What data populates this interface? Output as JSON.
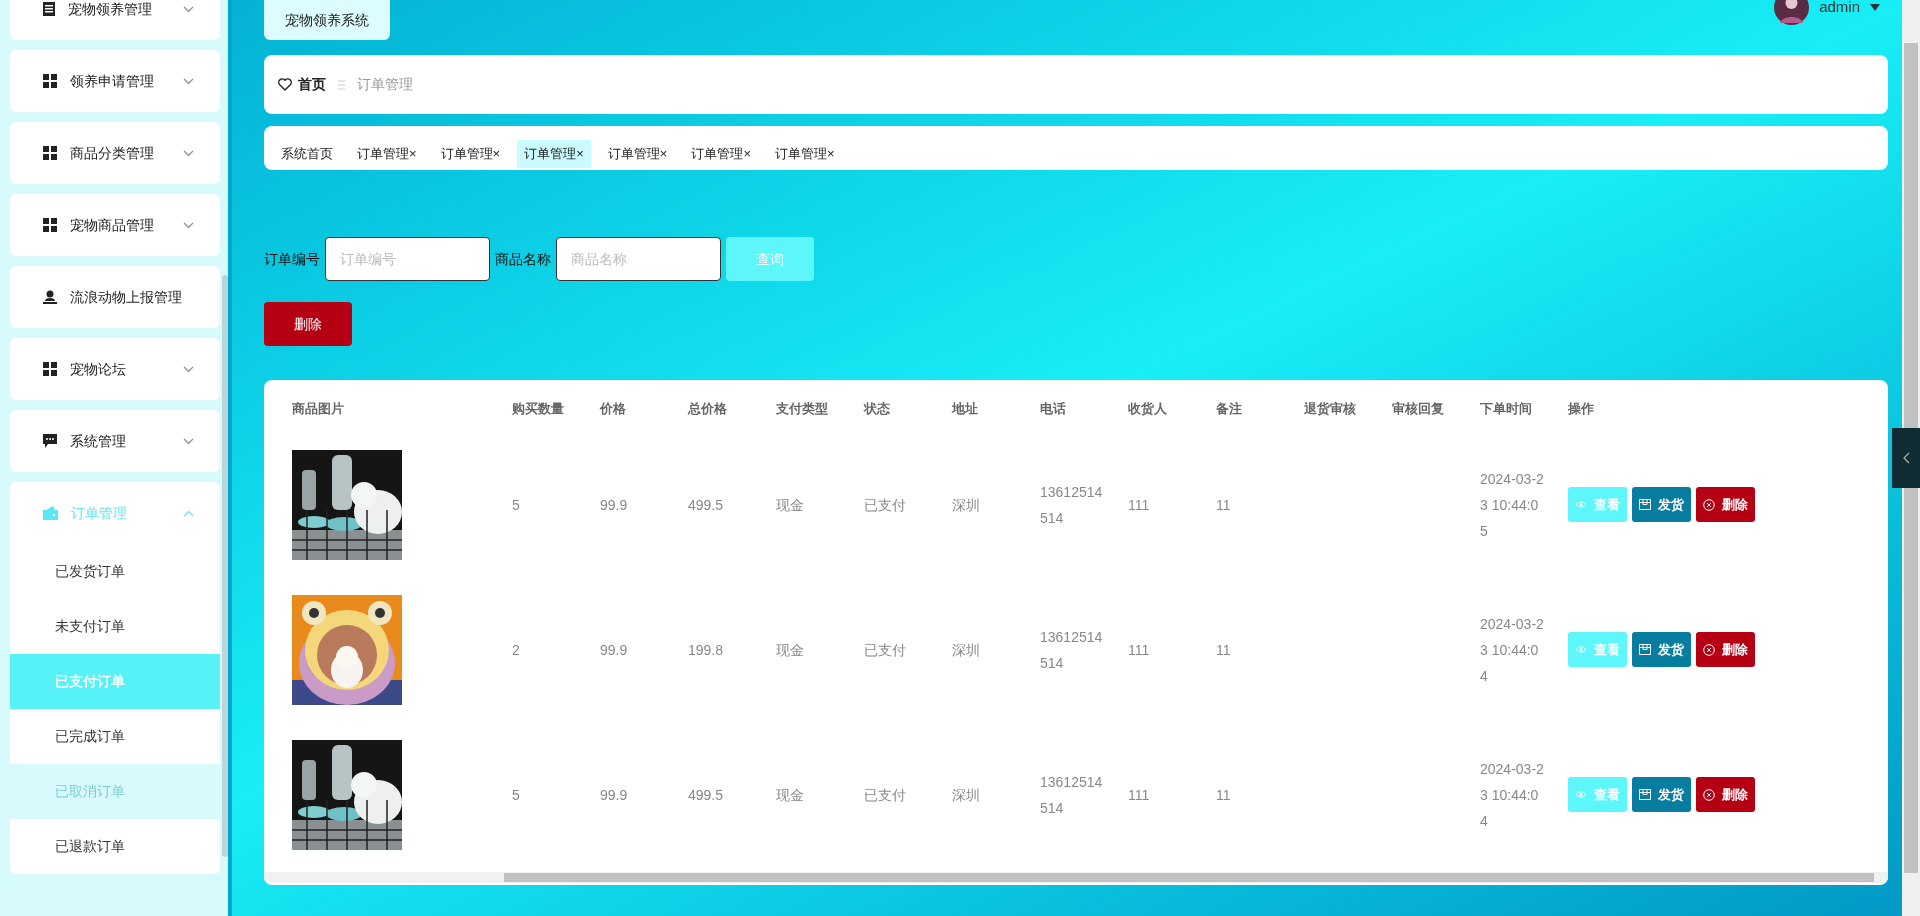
{
  "header": {
    "title": "宠物领养系统",
    "user": "admin"
  },
  "sidebar": {
    "items": [
      {
        "label": "宠物领养管理",
        "expanded": false,
        "kind": "submenu"
      },
      {
        "label": "领养申请管理",
        "expanded": false,
        "kind": "submenu"
      },
      {
        "label": "商品分类管理",
        "expanded": false,
        "kind": "submenu"
      },
      {
        "label": "宠物商品管理",
        "expanded": false,
        "kind": "submenu"
      },
      {
        "label": "流浪动物上报管理",
        "kind": "link"
      },
      {
        "label": "宠物论坛",
        "expanded": false,
        "kind": "submenu"
      },
      {
        "label": "系统管理",
        "expanded": false,
        "kind": "submenu"
      },
      {
        "label": "订单管理",
        "expanded": true,
        "kind": "submenu",
        "children": [
          {
            "label": "已发货订单",
            "selected": false,
            "hovered": false
          },
          {
            "label": "未支付订单",
            "selected": false,
            "hovered": false
          },
          {
            "label": "已支付订单",
            "selected": true,
            "hovered": false
          },
          {
            "label": "已完成订单",
            "selected": false,
            "hovered": false
          },
          {
            "label": "已取消订单",
            "selected": false,
            "hovered": true
          },
          {
            "label": "已退款订单",
            "selected": false,
            "hovered": false
          }
        ]
      }
    ]
  },
  "breadcrumb": {
    "home": "首页",
    "current": "订单管理"
  },
  "tabs": [
    {
      "label": "系统首页",
      "selected": false
    },
    {
      "label": "订单管理",
      "close": "×",
      "selected": false
    },
    {
      "label": "订单管理",
      "close": "×",
      "selected": false
    },
    {
      "label": "订单管理",
      "close": "×",
      "selected": true
    },
    {
      "label": "订单管理",
      "close": "×",
      "selected": false
    },
    {
      "label": "订单管理",
      "close": "×",
      "selected": false
    },
    {
      "label": "订单管理",
      "close": "×",
      "selected": false
    }
  ],
  "search": {
    "fields": [
      {
        "label": "订单编号",
        "placeholder": "订单编号"
      },
      {
        "label": "商品名称",
        "placeholder": "商品名称"
      }
    ],
    "query_button": "查询",
    "delete_button": "删除"
  },
  "table": {
    "columns": [
      "商品图片",
      "购买数量",
      "价格",
      "总价格",
      "支付类型",
      "状态",
      "地址",
      "电话",
      "收货人",
      "备注",
      "退货审核",
      "审核回复",
      "下单时间",
      "操作"
    ],
    "rows": [
      {
        "cells": [
          "",
          "5",
          "99.9",
          "499.5",
          "现金",
          "已支付",
          "深圳",
          "13612514514",
          "111",
          "11",
          "",
          "",
          "2024-03-23 10:44:05"
        ],
        "actions": [
          "查看",
          "发货",
          "删除"
        ]
      },
      {
        "cells": [
          "",
          "2",
          "99.9",
          "199.8",
          "现金",
          "已支付",
          "深圳",
          "13612514514",
          "111",
          "11",
          "",
          "",
          "2024-03-23 10:44:04"
        ],
        "actions": [
          "查看",
          "发货",
          "删除"
        ]
      },
      {
        "cells": [
          "",
          "5",
          "99.9",
          "499.5",
          "现金",
          "已支付",
          "深圳",
          "13612514514",
          "111",
          "11",
          "",
          "",
          "2024-03-23 10:44:04"
        ],
        "actions": [
          "查看",
          "发货",
          "删除"
        ]
      }
    ]
  }
}
